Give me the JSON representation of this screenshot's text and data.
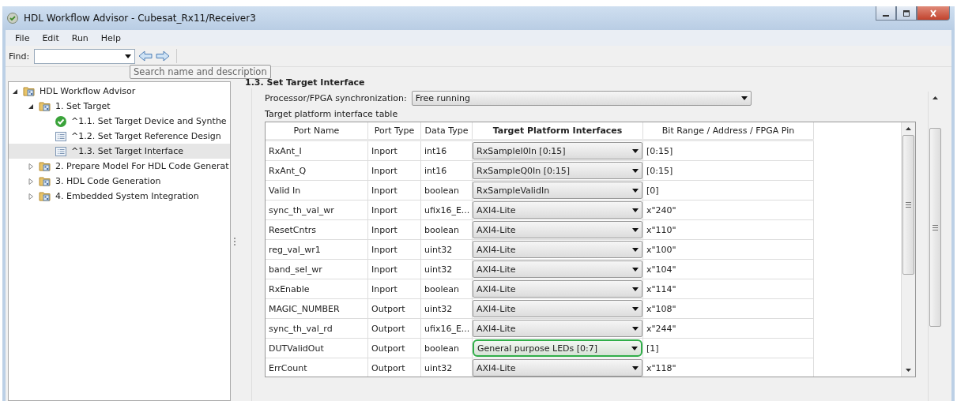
{
  "window": {
    "title": "HDL Workflow Advisor - Cubesat_Rx11/Receiver3"
  },
  "menu": [
    "File",
    "Edit",
    "Run",
    "Help"
  ],
  "find": {
    "label": "Find:",
    "tooltip": "Search name and description"
  },
  "tree": [
    {
      "label": "HDL Workflow Advisor",
      "kind": "folder",
      "expanded": true,
      "selected": false,
      "children": [
        {
          "label": "1. Set Target",
          "kind": "folder",
          "expanded": true,
          "selected": false,
          "children": [
            {
              "label": "^1.1. Set Target Device and Synthe",
              "kind": "passed",
              "selected": false
            },
            {
              "label": "^1.2. Set Target Reference Design",
              "kind": "task",
              "selected": false
            },
            {
              "label": "^1.3. Set Target Interface",
              "kind": "task",
              "selected": true
            }
          ]
        },
        {
          "label": "2. Prepare Model For HDL Code Generat",
          "kind": "folder",
          "expanded": false,
          "selected": false
        },
        {
          "label": "3. HDL Code Generation",
          "kind": "folder",
          "expanded": false,
          "selected": false
        },
        {
          "label": "4. Embedded System Integration",
          "kind": "folder",
          "expanded": false,
          "selected": false
        }
      ]
    }
  ],
  "section": {
    "title": "1.3. Set Target Interface",
    "sync_label": "Processor/FPGA synchronization:",
    "sync_value": "Free running",
    "table_caption": "Target platform interface table",
    "table": {
      "columns": [
        "Port Name",
        "Port Type",
        "Data Type",
        "Target Platform Interfaces",
        "Bit Range / Address / FPGA Pin"
      ],
      "rows": [
        {
          "cells": [
            "RxAnt_I",
            "Inport",
            "int16",
            "RxSampleI0In [0:15]",
            "[0:15]"
          ],
          "highlighted": false
        },
        {
          "cells": [
            "RxAnt_Q",
            "Inport",
            "int16",
            "RxSampleQ0In [0:15]",
            "[0:15]"
          ],
          "highlighted": false
        },
        {
          "cells": [
            "Valid In",
            "Inport",
            "boolean",
            "RxSampleValidIn",
            "[0]"
          ],
          "highlighted": false
        },
        {
          "cells": [
            "sync_th_val_wr",
            "Inport",
            "ufix16_E...",
            "AXI4-Lite",
            "x\"240\""
          ],
          "highlighted": false
        },
        {
          "cells": [
            "ResetCntrs",
            "Inport",
            "boolean",
            "AXI4-Lite",
            "x\"110\""
          ],
          "highlighted": false
        },
        {
          "cells": [
            "reg_val_wr1",
            "Inport",
            "uint32",
            "AXI4-Lite",
            "x\"100\""
          ],
          "highlighted": false
        },
        {
          "cells": [
            "band_sel_wr",
            "Inport",
            "uint32",
            "AXI4-Lite",
            "x\"104\""
          ],
          "highlighted": false
        },
        {
          "cells": [
            "RxEnable",
            "Inport",
            "boolean",
            "AXI4-Lite",
            "x\"114\""
          ],
          "highlighted": false
        },
        {
          "cells": [
            "MAGIC_NUMBER",
            "Outport",
            "uint32",
            "AXI4-Lite",
            "x\"108\""
          ],
          "highlighted": false
        },
        {
          "cells": [
            "sync_th_val_rd",
            "Outport",
            "ufix16_E...",
            "AXI4-Lite",
            "x\"244\""
          ],
          "highlighted": false
        },
        {
          "cells": [
            "DUTValidOut",
            "Outport",
            "boolean",
            "General purpose LEDs [0:7]",
            "[1]"
          ],
          "highlighted": true
        },
        {
          "cells": [
            "ErrCount",
            "Outport",
            "uint32",
            "AXI4-Lite",
            "x\"118\""
          ],
          "highlighted": false
        }
      ]
    }
  }
}
